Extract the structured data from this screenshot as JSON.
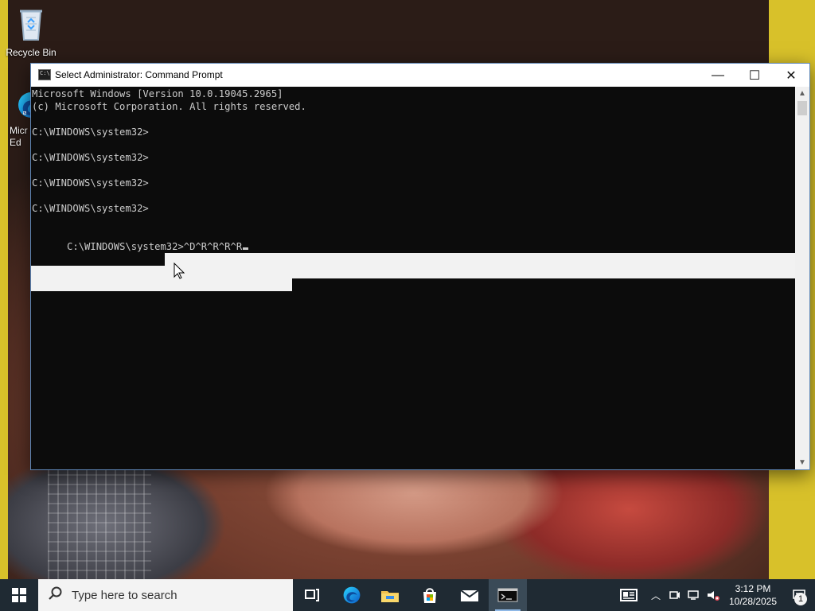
{
  "desktop": {
    "icons": [
      {
        "label": "Recycle Bin"
      },
      {
        "label": "Micr\nEd"
      }
    ]
  },
  "window": {
    "title": "Select Administrator: Command Prompt",
    "controls": {
      "minimize": "—",
      "maximize": "☐",
      "close": "✕"
    },
    "console_lines": [
      "Microsoft Windows [Version 10.0.19045.2965]",
      "(c) Microsoft Corporation. All rights reserved.",
      "",
      "C:\\WINDOWS\\system32>",
      "",
      "C:\\WINDOWS\\system32>",
      "",
      "C:\\WINDOWS\\system32>",
      "",
      "C:\\WINDOWS\\system32>",
      "",
      "C:\\WINDOWS\\system32>^D^R^R^R^R"
    ]
  },
  "taskbar": {
    "search_placeholder": "Type here to search",
    "time": "3:12 PM",
    "date": "10/28/2025",
    "notifications_count": "1"
  }
}
